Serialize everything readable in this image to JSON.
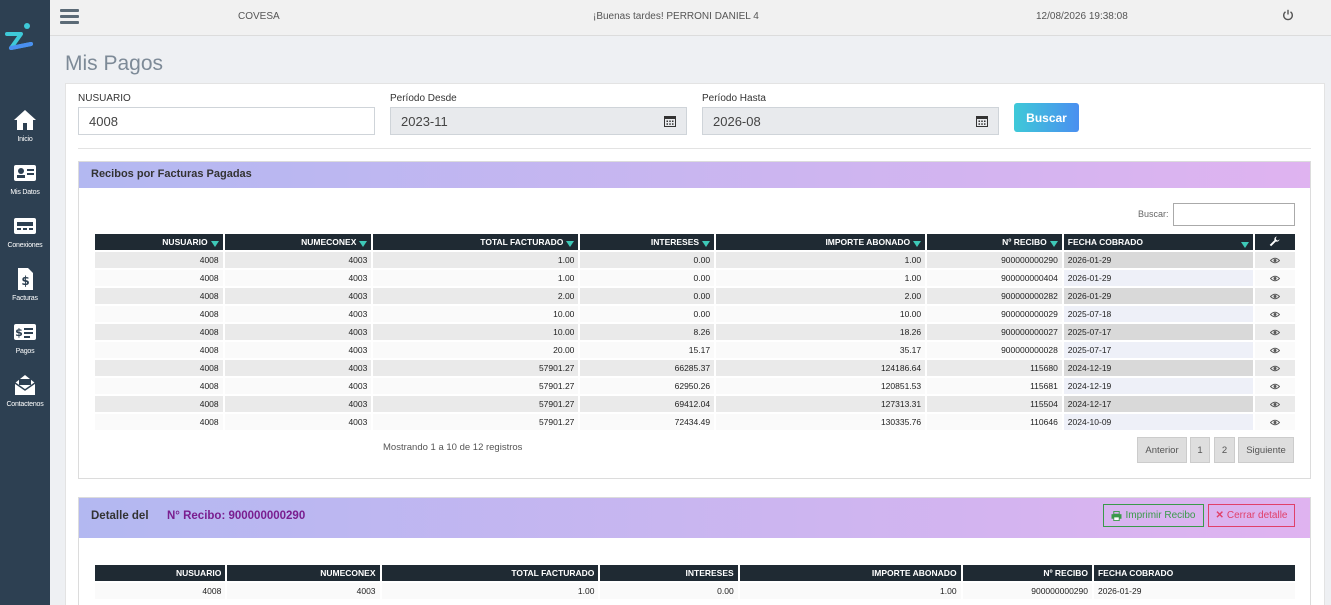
{
  "topbar": {
    "company": "COVESA",
    "greeting": "¡Buenas tardes! PERRONI DANIEL 4",
    "datetime": "12/08/2026 19:38:08"
  },
  "sidebar": {
    "items": [
      {
        "label": "Inicio",
        "icon": "home-icon"
      },
      {
        "label": "Mis Datos",
        "icon": "id-card-icon"
      },
      {
        "label": "Conexiones",
        "icon": "meter-icon"
      },
      {
        "label": "Facturas",
        "icon": "invoice-icon"
      },
      {
        "label": "Pagos",
        "icon": "payment-icon"
      },
      {
        "label": "Contactenos",
        "icon": "mail-icon"
      }
    ]
  },
  "page": {
    "title": "Mis Pagos"
  },
  "filters": {
    "nusuario_label": "NUSUARIO",
    "nusuario_value": "4008",
    "desde_label": "Período Desde",
    "desde_value": "2023-11",
    "hasta_label": "Período Hasta",
    "hasta_value": "2026-08",
    "buscar_label": "Buscar"
  },
  "recibos": {
    "title": "Recibos por Facturas Pagadas",
    "search_label": "Buscar:",
    "columns": [
      "NUSUARIO",
      "NUMECONEX",
      "TOTAL FACTURADO",
      "INTERESES",
      "IMPORTE ABONADO",
      "Nº RECIBO",
      "FECHA COBRADO"
    ],
    "rows": [
      [
        "4008",
        "4003",
        "1.00",
        "0.00",
        "1.00",
        "900000000290",
        "2026-01-29"
      ],
      [
        "4008",
        "4003",
        "1.00",
        "0.00",
        "1.00",
        "900000000404",
        "2026-01-29"
      ],
      [
        "4008",
        "4003",
        "2.00",
        "0.00",
        "2.00",
        "900000000282",
        "2026-01-29"
      ],
      [
        "4008",
        "4003",
        "10.00",
        "0.00",
        "10.00",
        "900000000029",
        "2025-07-18"
      ],
      [
        "4008",
        "4003",
        "10.00",
        "8.26",
        "18.26",
        "900000000027",
        "2025-07-17"
      ],
      [
        "4008",
        "4003",
        "20.00",
        "15.17",
        "35.17",
        "900000000028",
        "2025-07-17"
      ],
      [
        "4008",
        "4003",
        "57901.27",
        "66285.37",
        "124186.64",
        "115680",
        "2024-12-19"
      ],
      [
        "4008",
        "4003",
        "57901.27",
        "62950.26",
        "120851.53",
        "115681",
        "2024-12-19"
      ],
      [
        "4008",
        "4003",
        "57901.27",
        "69412.04",
        "127313.31",
        "115504",
        "2024-12-17"
      ],
      [
        "4008",
        "4003",
        "57901.27",
        "72434.49",
        "130335.76",
        "110646",
        "2024-10-09"
      ]
    ],
    "info": "Mostrando 1 a 10 de 12 registros",
    "pagination": {
      "prev": "Anterior",
      "p1": "1",
      "p2": "2",
      "next": "Siguiente"
    }
  },
  "detalle": {
    "title": "Detalle del",
    "recibo": "N° Recibo: 900000000290",
    "print_label": "Imprimir Recibo",
    "close_label": "Cerrar detalle",
    "columns": [
      "NUSUARIO",
      "NUMECONEX",
      "TOTAL FACTURADO",
      "INTERESES",
      "IMPORTE ABONADO",
      "Nº RECIBO",
      "FECHA COBRADO"
    ],
    "row": [
      "4008",
      "4003",
      "1.00",
      "0.00",
      "1.00",
      "900000000290",
      "2026-01-29"
    ]
  },
  "colors": {
    "sidebar": "#2d4052",
    "accent_start": "#3ec9d8",
    "accent_end": "#4a8ff0",
    "recibo_highlight": "#7a1e8f"
  }
}
